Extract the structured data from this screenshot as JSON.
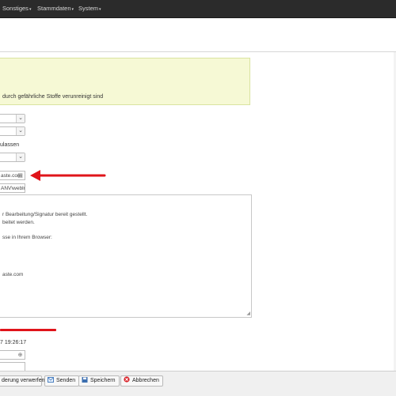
{
  "navbar": {
    "items": [
      {
        "label": "Sonstiges"
      },
      {
        "label": "Stammdaten"
      },
      {
        "label": "System"
      }
    ]
  },
  "alert": {
    "text": "durch gefährliche Stoffe verunreinigt sind"
  },
  "form": {
    "label_zulassen": "ulassen",
    "email_field_value": "aste.com",
    "path_field_value": "ANV\\weblr",
    "date_value": "7 19:26:17"
  },
  "textarea": {
    "lines": [
      "r Bearbeitung/Signatur bereit gestellt.",
      "beitet werden.",
      "sse in Ihrem Browser:",
      "aste.com"
    ]
  },
  "buttons": {
    "discard": "derung verwerfen",
    "send": "Senden",
    "save": "Speichern",
    "cancel": "Abbrechen"
  },
  "colors": {
    "navbar_bg": "#2b2b2b",
    "alert_bg": "#f6f9d5",
    "annotation_red": "#e0141a",
    "cancel_icon": "#d9232a"
  }
}
